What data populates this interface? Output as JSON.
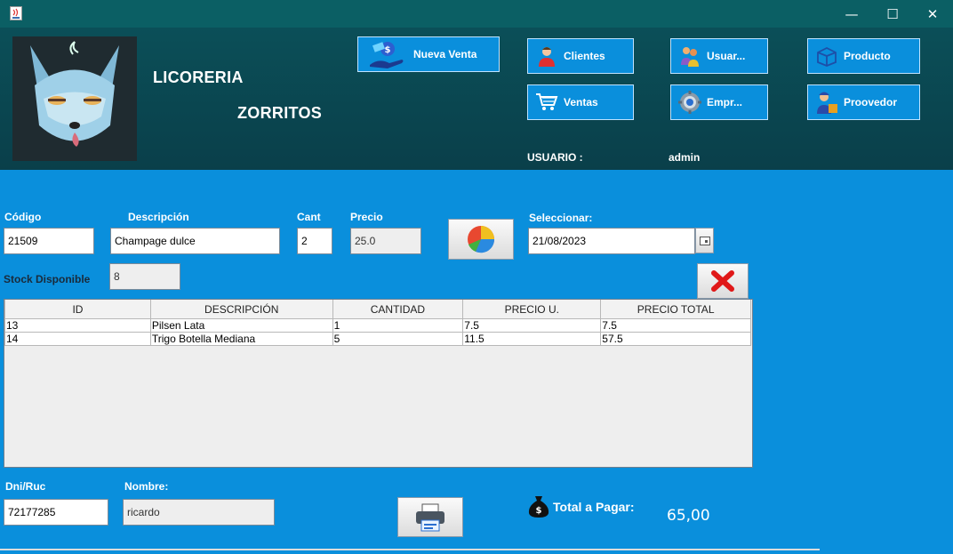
{
  "window": {
    "minimize": "—",
    "maximize": "☐",
    "close": "✕"
  },
  "header": {
    "title_line1": "LICORERIA",
    "title_line2": "ZORRITOS",
    "user_label": "USUARIO :",
    "user_value": "admin"
  },
  "nav": {
    "nueva_venta": "Nueva Venta",
    "clientes": "Clientes",
    "usuarios": "Usuar...",
    "producto": "Producto",
    "ventas": "Ventas",
    "empresa": "Empr...",
    "proveedor": "Proovedor"
  },
  "form": {
    "codigo_label": "Código",
    "codigo_value": "21509",
    "descripcion_label": "Descripción",
    "descripcion_value": "Champage dulce",
    "cant_label": "Cant",
    "cant_value": "2",
    "precio_label": "Precio",
    "precio_value": "25.0",
    "seleccionar_label": "Seleccionar:",
    "fecha_value": "21/08/2023",
    "stock_label": "Stock Disponible",
    "stock_value": "8"
  },
  "table": {
    "headers": [
      "ID",
      "DESCRIPCIÓN",
      "CANTIDAD",
      "PRECIO U.",
      "PRECIO TOTAL"
    ],
    "rows": [
      [
        "13",
        "Pilsen Lata",
        "1",
        "7.5",
        "7.5"
      ],
      [
        "14",
        "Trigo Botella Mediana",
        "5",
        "11.5",
        "57.5"
      ]
    ]
  },
  "footer": {
    "dni_label": "Dni/Ruc",
    "dni_value": "72177285",
    "nombre_label": "Nombre:",
    "nombre_value": "ricardo",
    "total_label": "Total a Pagar:",
    "total_value": "65,00"
  }
}
